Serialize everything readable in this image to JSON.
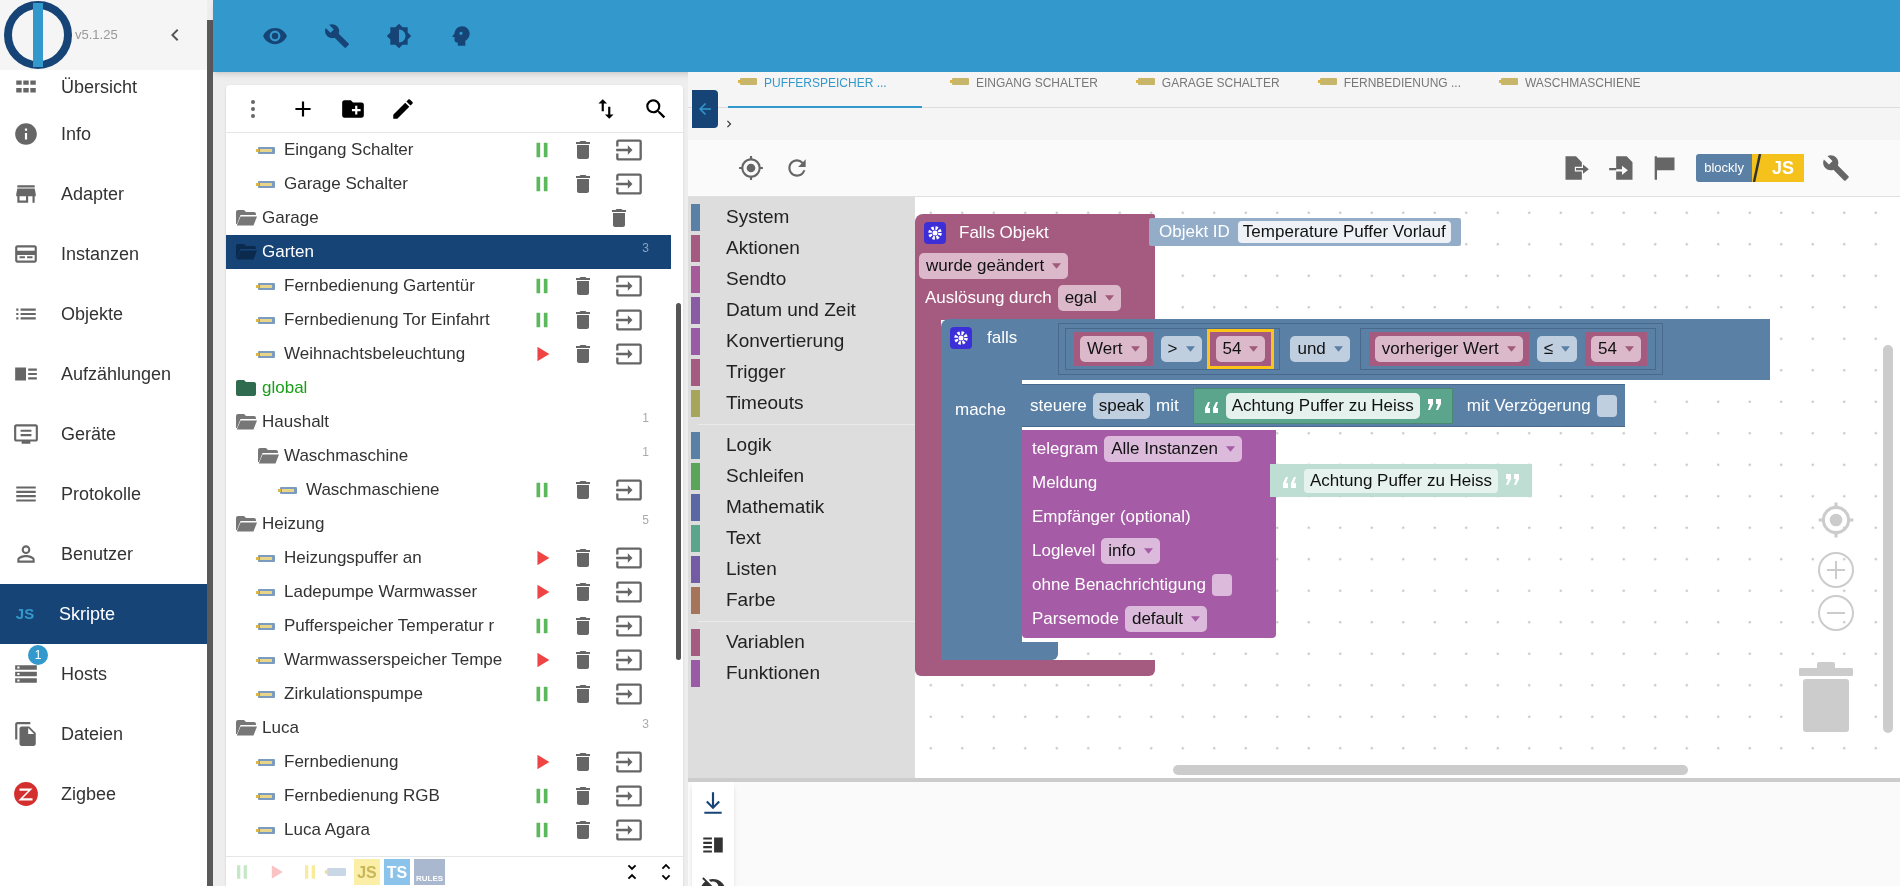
{
  "app": {
    "version": "v5.1.25"
  },
  "sidebar": {
    "items": [
      {
        "label": "Übersicht",
        "selected": false
      },
      {
        "label": "Info",
        "selected": false
      },
      {
        "label": "Adapter",
        "selected": false
      },
      {
        "label": "Instanzen",
        "selected": false
      },
      {
        "label": "Objekte",
        "selected": false
      },
      {
        "label": "Aufzählungen",
        "selected": false
      },
      {
        "label": "Geräte",
        "selected": false
      },
      {
        "label": "Protokolle",
        "selected": false
      },
      {
        "label": "Benutzer",
        "selected": false
      },
      {
        "label": "Skripte",
        "selected": true,
        "icon_text": "JS"
      },
      {
        "label": "Hosts",
        "selected": false,
        "badge": "1"
      },
      {
        "label": "Dateien",
        "selected": false
      },
      {
        "label": "Zigbee",
        "selected": false
      }
    ]
  },
  "script_tree": {
    "scrolled_folder_children": [
      {
        "kind": "script",
        "name": "Eingang Schalter",
        "running": true,
        "selected": false
      },
      {
        "kind": "script",
        "name": "Garage Schalter",
        "running": true,
        "selected": false
      }
    ],
    "items": [
      {
        "kind": "folder",
        "name": "Garage",
        "selected": false
      },
      {
        "kind": "folder",
        "name": "Garten",
        "count": "3",
        "selected": true,
        "children": [
          {
            "kind": "script",
            "name": "Fernbedienung Gartentür",
            "running": true,
            "selected": false
          },
          {
            "kind": "script",
            "name": "Fernbedienung Tor Einfahrt",
            "running": true,
            "selected": false
          },
          {
            "kind": "script",
            "name": "Weihnachtsbeleuchtung",
            "running": false,
            "selected": false
          }
        ]
      },
      {
        "kind": "global-folder",
        "name": "global",
        "selected": false
      },
      {
        "kind": "folder",
        "name": "Haushalt",
        "count": "1",
        "selected": false,
        "children": [
          {
            "kind": "folder",
            "name": "Waschmaschine",
            "count": "1",
            "selected": false,
            "children": [
              {
                "kind": "script",
                "name": "Waschmaschiene",
                "running": true,
                "selected": false
              }
            ]
          }
        ]
      },
      {
        "kind": "folder",
        "name": "Heizung",
        "count": "5",
        "selected": false,
        "children": [
          {
            "kind": "script",
            "name": "Heizungspuffer an",
            "running": false,
            "selected": false
          },
          {
            "kind": "script",
            "name": "Ladepumpe Warmwasser",
            "running": false,
            "selected": false
          },
          {
            "kind": "script",
            "name": "Pufferspeicher Temperatur r",
            "running": true,
            "selected": false
          },
          {
            "kind": "script",
            "name": "Warmwasserspeicher Tempe",
            "running": false,
            "selected": false
          },
          {
            "kind": "script",
            "name": "Zirkulationspumpe",
            "running": true,
            "selected": false
          }
        ]
      },
      {
        "kind": "folder",
        "name": "Luca",
        "count": "3",
        "selected": false,
        "children": [
          {
            "kind": "script",
            "name": "Fernbedienung",
            "running": false,
            "selected": false
          },
          {
            "kind": "script",
            "name": "Fernbedienung RGB",
            "running": true,
            "selected": false
          },
          {
            "kind": "script",
            "name": "Luca Agara",
            "running": true,
            "selected": false
          }
        ]
      }
    ],
    "filters": [
      {
        "kind": "running"
      },
      {
        "kind": "stopped"
      },
      {
        "kind": "paused"
      },
      {
        "kind": "blockly"
      },
      {
        "kind": "js",
        "label": "JS"
      },
      {
        "kind": "ts",
        "label": "TS"
      },
      {
        "kind": "rules",
        "label": "RULES"
      }
    ]
  },
  "tabs": [
    {
      "label": "PUFFERSPEICHER ...",
      "selected": true
    },
    {
      "label": "EINGANG SCHALTER",
      "selected": false
    },
    {
      "label": "GARAGE SCHALTER",
      "selected": false
    },
    {
      "label": "FERNBEDIENUNG ...",
      "selected": false
    },
    {
      "label": "WASCHMASCHIENE",
      "selected": false
    }
  ],
  "mode_toggle": {
    "left": "blockly",
    "right": "JS"
  },
  "toolbox": {
    "groups": [
      [
        {
          "label": "System",
          "color": "#5b80a5"
        },
        {
          "label": "Aktionen",
          "color": "#a55b80"
        },
        {
          "label": "Sendto",
          "color": "#a55b99"
        },
        {
          "label": "Datum und Zeit",
          "color": "#8a5ba5"
        },
        {
          "label": "Konvertierung",
          "color": "#995ba5"
        },
        {
          "label": "Trigger",
          "color": "#a55b80"
        },
        {
          "label": "Timeouts",
          "color": "#a5a55b"
        }
      ],
      [
        {
          "label": "Logik",
          "color": "#5b80a5"
        },
        {
          "label": "Schleifen",
          "color": "#5ba55b"
        },
        {
          "label": "Mathematik",
          "color": "#5b67a5"
        },
        {
          "label": "Text",
          "color": "#5ba58c"
        },
        {
          "label": "Listen",
          "color": "#745ba5"
        },
        {
          "label": "Farbe",
          "color": "#a5745b"
        }
      ],
      [
        {
          "label": "Variablen",
          "color": "#a55b80"
        },
        {
          "label": "Funktionen",
          "color": "#995ba5"
        }
      ]
    ]
  },
  "blocks": {
    "trigger": {
      "title": "Falls Objekt",
      "object_label": "Objekt ID",
      "object_id": "Temperature Puffer Vorlauf",
      "event": "wurde geändert",
      "source_label": "Auslösung durch",
      "source": "egal"
    },
    "if": {
      "label": "falls",
      "do_label": "mache",
      "joiner": "und",
      "left": {
        "value": "Wert",
        "op": ">",
        "num": "54",
        "selected": true
      },
      "right": {
        "value": "vorheriger Wert",
        "op": "≤",
        "num": "54",
        "selected": false
      }
    },
    "control": {
      "label": "steuere",
      "target": "speak",
      "with_label": "mit",
      "text": "Achtung Puffer zu Heiss",
      "delay_label": "mit Verzögerung",
      "delay": false
    },
    "telegram": {
      "label": "telegram",
      "instance": "Alle Instanzen",
      "rows": [
        {
          "kind": "input",
          "label": "Meldung"
        },
        {
          "kind": "input",
          "label": "Empfänger (optional)"
        },
        {
          "kind": "dropdown",
          "label": "Loglevel",
          "value": "info"
        },
        {
          "kind": "checkbox",
          "label": "ohne Benachrichtigung",
          "checked": false
        },
        {
          "kind": "dropdown",
          "label": "Parsemode",
          "value": "default"
        }
      ]
    },
    "loose_text": {
      "text": "Achtung Puffer zu Heiss"
    }
  }
}
